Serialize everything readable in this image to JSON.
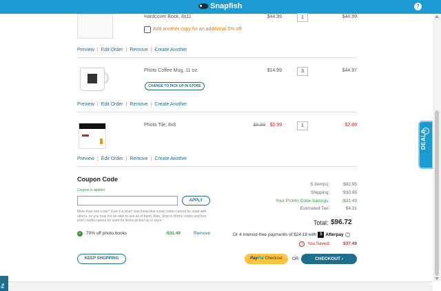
{
  "header": {
    "brand": "Snapfish",
    "help_icon": "?"
  },
  "items": [
    {
      "title": "Hardcover Book, 8x11",
      "price": "$44.99",
      "qty": "1",
      "total": "$44.99",
      "upsell": "Add another copy for an additional 5% off",
      "links": [
        "Preview",
        "Edit Order",
        "Remove",
        "Create Another"
      ]
    },
    {
      "title": "Photo Coffee Mug, 11 oz.",
      "price": "$14.99",
      "qty": "3",
      "total": "$44.97",
      "pickup_button": "CHANGE TO PICK UP IN STORE",
      "links": [
        "Preview",
        "Edit Order",
        "Remove",
        "Create Another"
      ]
    },
    {
      "title": "Photo Tile, 8x8",
      "original_price": "$8.99",
      "price": "$2.99",
      "qty": "1",
      "total": "$2.99",
      "links": [
        "Preview",
        "Edit Order",
        "Remove",
        "Create Another"
      ]
    }
  ],
  "coupon": {
    "title": "Coupon Code",
    "applied_msg": "Coupon is applied",
    "input_value": "",
    "apply_label": "APPLY",
    "note": "More than one code? Give it a whirl! Just know that some codes cannot be used with others, so you may not be able to use all of them. Also, Ship to Home codes and free print credits cannot be used for items picked up in store.",
    "applied_name": "70% off photo books",
    "applied_amount": "-$31.49",
    "remove_label": "Remove"
  },
  "summary": {
    "items_label": "5 item(s):",
    "items_value": "$92.95",
    "shipping_label": "Shipping:",
    "shipping_value": "$30.95",
    "promo_label": "Your Promo Code Savings:",
    "promo_value": "-$31.49",
    "tax_label": "Estimated Tax:",
    "tax_value": "$4.31",
    "total_label": "Total:",
    "total_value": "$96.72",
    "afterpay_text": "Or 4 interest-free payments of $24.18 with",
    "afterpay_brand": "Afterpay",
    "saved_label": "You Saved:",
    "saved_value": "$37.49"
  },
  "actions": {
    "keep_shopping": "KEEP SHOPPING",
    "paypal_pay": "Pay",
    "paypal_pal": "Pal",
    "paypal_checkout": "Checkout",
    "or": "OR",
    "checkout": "CHECKOUT ›"
  },
  "side": {
    "deals": "DEALS",
    "deals_icon": "‹",
    "feedback": "Fe"
  },
  "colors": {
    "brand_blue": "#1b9bd1",
    "dark_teal": "#1d6e8c",
    "sale_red": "#c62828",
    "success_green": "#3a9a3a",
    "upsell_orange": "#e07b00"
  }
}
